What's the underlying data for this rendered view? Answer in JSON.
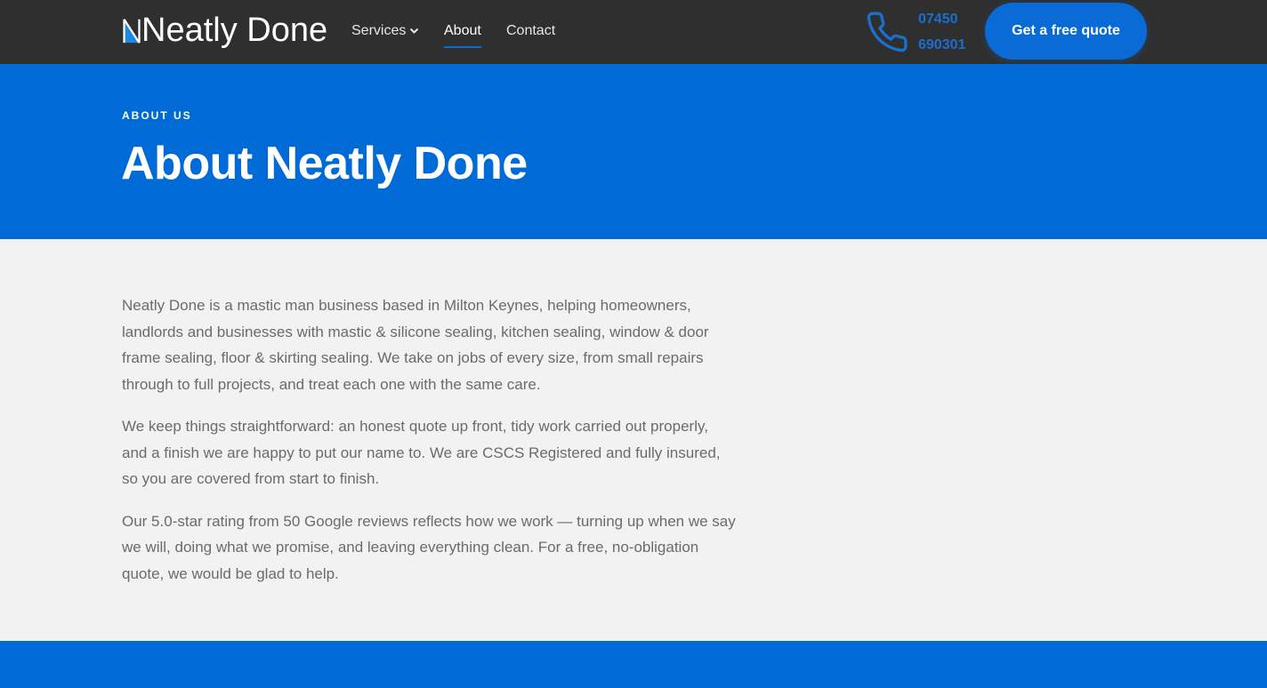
{
  "header": {
    "logo_text": "Neatly Done",
    "nav": [
      {
        "label": "Services",
        "has_dropdown": true,
        "active": false
      },
      {
        "label": "About",
        "has_dropdown": false,
        "active": true
      },
      {
        "label": "Contact",
        "has_dropdown": false,
        "active": false
      }
    ],
    "phone_icon": "phone-icon",
    "phone_line1": "07450",
    "phone_line2": "690301",
    "cta_label": "Get a free quote"
  },
  "hero": {
    "eyebrow": "ABOUT US",
    "title": "About Neatly Done"
  },
  "content": {
    "paragraphs": [
      "Neatly Done is a mastic man business based in Milton Keynes, helping homeowners, landlords and businesses with mastic & silicone sealing, kitchen sealing, window & door frame sealing, floor & skirting sealing. We take on jobs of every size, from small repairs through to full projects, and treat each one with the same care.",
      "We keep things straightforward: an honest quote up front, tidy work carried out properly, and a finish we are happy to put our name to. We are CSCS Registered and fully insured, so you are covered from start to finish.",
      "Our 5.0-star rating from 50 Google reviews reflects how we work — turning up when we say we will, doing what we promise, and leaving everything clean. For a free, no-obligation quote, we would be glad to help."
    ]
  },
  "colors": {
    "topbar": "#2f2f2f",
    "brand_blue": "#006bd6",
    "body_bg": "#f2f2f2",
    "body_text": "#6b6b6b"
  }
}
